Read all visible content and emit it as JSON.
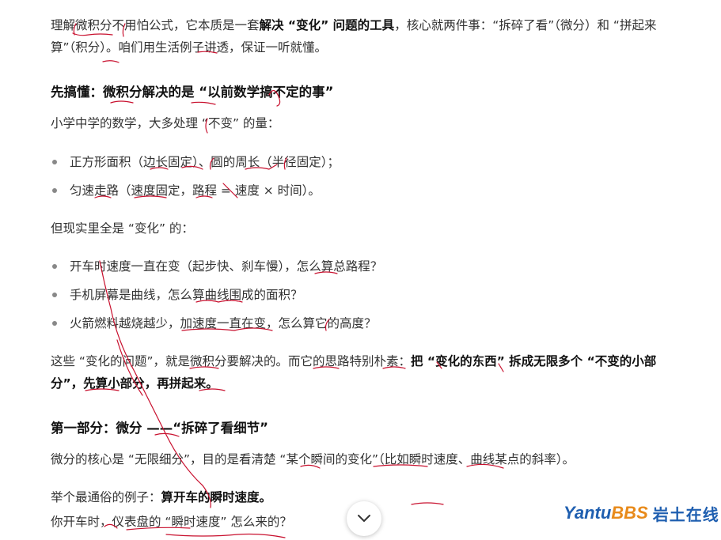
{
  "intro": {
    "l1_a": "理解微积分不用怕公式，它本质是一套",
    "l1_b": "解决 “变化” 问题的工具",
    "l1_c": "，核心就两件事：“拆碎了看”（微分）和 “拼起来",
    "l2": "算”（积分）。咱们用生活例子讲透，保证一听就懂。"
  },
  "section1": {
    "heading": "先搞懂：微积分解决的是 “以前数学搞不定的事”",
    "p1": "小学中学的数学，大多处理 “不变” 的量：",
    "list1": [
      "正方形面积（边长固定）、圆的周长（半径固定）；",
      "匀速走路（速度固定，路程 = 速度 × 时间）。"
    ],
    "p2": "但现实里全是 “变化” 的：",
    "list2": [
      "开车时速度一直在变（起步快、刹车慢），怎么算总路程？",
      "手机屏幕是曲线，怎么算曲线围成的面积？",
      "火箭燃料越烧越少，加速度一直在变，怎么算它的高度？"
    ],
    "p3_a": "这些 “变化的问题”，就是微积分要解决的。而它的思路特别朴素：",
    "p3_b": "把 “变化的东西” 拆成无限多个 “不变的小部",
    "p3_c": "分”，先算小部分，再拼起来。"
  },
  "section2": {
    "heading": "第一部分：微分 ——“拆碎了看细节”",
    "p1": "微分的核心是 “无限细分”，目的是看清楚 “某个瞬间的变化”（比如瞬时速度、曲线某点的斜率）。",
    "p2_a": "举个最通俗的例子：",
    "p2_b": "算开车的瞬时速度。",
    "p3": "你开车时，仪表盘的 “瞬时速度” 怎么来的？"
  },
  "watermark": {
    "part1": "Yantu",
    "part2": "BBS",
    "part3": "岩土在线"
  },
  "colors": {
    "annotation": "#c8102e",
    "watermark_blue": "#1f5fb0",
    "watermark_orange": "#e88a1a"
  }
}
